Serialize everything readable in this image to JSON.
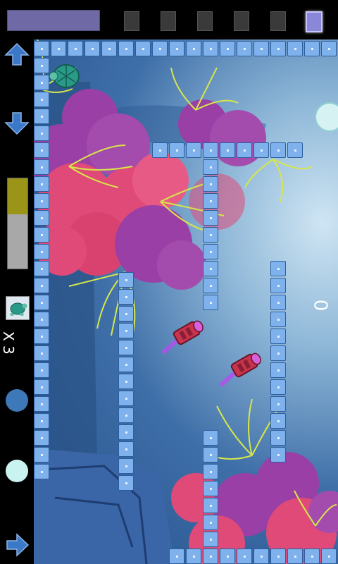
{
  "hud": {
    "score": "0",
    "lives_text": "X 3",
    "power_level": 0.4
  },
  "toolbar": {
    "tools": [
      {
        "icon": "ink-splat-icon",
        "active": false
      },
      {
        "icon": "square-block-icon",
        "active": false
      },
      {
        "icon": "gear-block-icon",
        "active": false
      },
      {
        "icon": "bolt-block-icon",
        "active": false
      },
      {
        "icon": "arrow-block-icon",
        "active": false
      },
      {
        "icon": "blue-block-icon",
        "active": true
      }
    ]
  },
  "controls": {
    "up_arrow_icon": "up-arrow-icon",
    "down_arrow_icon": "down-arrow-icon",
    "right_arrow_icon": "right-arrow-icon",
    "button_1_color": "#3d78b8",
    "button_2_color": "#c9f3f0"
  },
  "colors": {
    "tile": "#7fb2ec",
    "coral_pink": "#e04a78",
    "coral_purple": "#9a3fa6",
    "seaweed": "#d7e64a",
    "submarine": "#c8344e"
  }
}
